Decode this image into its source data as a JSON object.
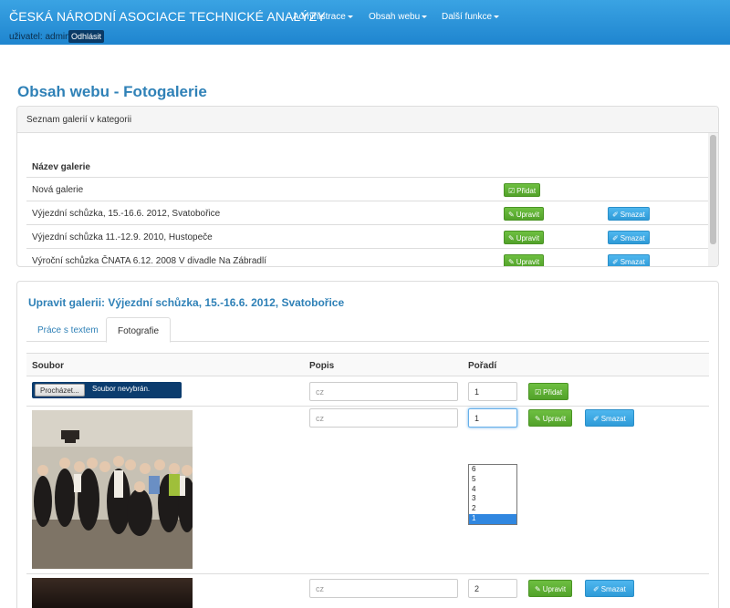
{
  "header": {
    "brand": "ČESKÁ NÁRODNÍ ASOCIACE TECHNICKÉ ANALÝZY",
    "nav": [
      "Administrace",
      "Obsah webu",
      "Další funkce"
    ],
    "user_label": "uživatel: admin",
    "logout": "Odhlásit"
  },
  "page_title": "Obsah webu - Fotogalerie",
  "galleries_panel": {
    "heading": "Seznam galerií v kategorii",
    "column_name": "Název galerie",
    "rows": [
      {
        "name": "Nová galerie",
        "actions": [
          "Přidat"
        ]
      },
      {
        "name": "Výjezdní schůzka, 15.-16.6. 2012, Svatobořice",
        "actions": [
          "Upravit",
          "Smazat"
        ]
      },
      {
        "name": "Výjezdní schůzka 11.-12.9. 2010, Hustopeče",
        "actions": [
          "Upravit",
          "Smazat"
        ]
      },
      {
        "name": "Výroční schůzka ČNATA 6.12. 2008 V divadle Na Zábradlí",
        "actions": [
          "Upravit",
          "Smazat"
        ]
      }
    ]
  },
  "edit_panel": {
    "title": "Upravit galerii: Výjezdní schůzka, 15.-16.6. 2012, Svatobořice",
    "tabs": [
      "Práce s textem",
      "Fotografie"
    ],
    "active_tab": "Fotografie",
    "columns": {
      "file": "Soubor",
      "description": "Popis",
      "order": "Pořadí"
    },
    "upload": {
      "browse": "Procházet...",
      "no_file": "Soubor nevybrán.",
      "desc_placeholder": "cz",
      "order": "1",
      "add": "Přidat"
    },
    "photos": [
      {
        "desc_placeholder": "cz",
        "order": "1",
        "edit": "Upravit",
        "delete": "Smazat"
      },
      {
        "desc_placeholder": "cz",
        "order": "2",
        "edit": "Upravit",
        "delete": "Smazat"
      }
    ],
    "order_options": [
      "6",
      "5",
      "4",
      "3",
      "2",
      "1"
    ],
    "order_selected": "1"
  },
  "colors": {
    "primary": "#2f81b7",
    "topbar": "#2a93da",
    "green": "#5fb236",
    "blue": "#3aa6e3"
  }
}
